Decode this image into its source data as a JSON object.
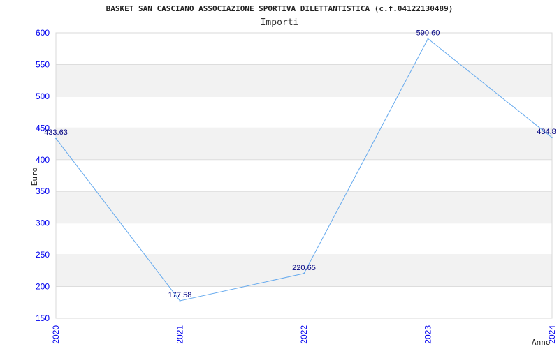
{
  "chart_data": {
    "type": "line",
    "title": "BASKET SAN CASCIANO ASSOCIAZIONE SPORTIVA DILETTANTISTICA (c.f.04122130489)",
    "subtitle": "Importi",
    "xlabel": "Anno",
    "ylabel": "Euro",
    "categories": [
      "2020",
      "2021",
      "2022",
      "2023",
      "2024"
    ],
    "values": [
      433.63,
      177.58,
      220.65,
      590.6,
      434.8
    ],
    "data_labels": [
      "433.63",
      "177.58",
      "220.65",
      "590.60",
      "434.8"
    ],
    "ylim": [
      150,
      600
    ],
    "yticks": [
      150,
      200,
      250,
      300,
      350,
      400,
      450,
      500,
      550,
      600
    ],
    "grid": true,
    "line_color": "#66aaee",
    "tick_color": "#0000ee",
    "label_color": "#000080",
    "band_color": "#f2f2f2"
  }
}
